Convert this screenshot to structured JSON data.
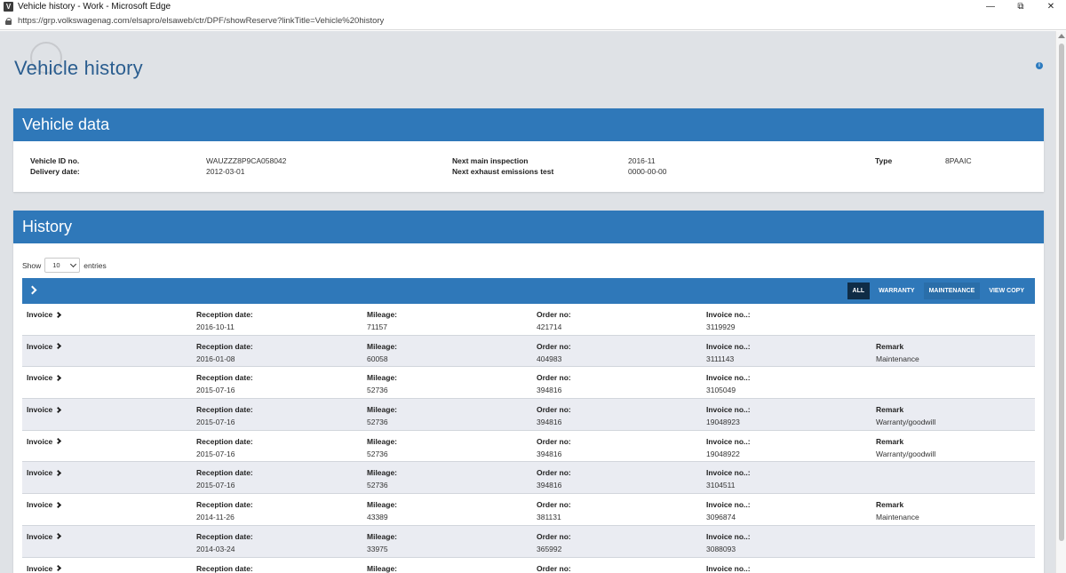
{
  "window": {
    "app_icon": "V",
    "title": "Vehicle history - Work - Microsoft Edge",
    "url": "https://grp.volkswagenag.com/elsapro/elsaweb/ctr/DPF/showReserve?linkTitle=Vehicle%20history"
  },
  "page": {
    "title": "Vehicle history",
    "info_icon": "i"
  },
  "vehicle_data": {
    "header": "Vehicle data",
    "vehicle_id_label": "Vehicle ID no.",
    "vehicle_id": "WAUZZZ8P9CA058042",
    "delivery_date_label": "Delivery date:",
    "delivery_date": "2012-03-01",
    "next_inspection_label": "Next main inspection",
    "next_inspection": "2016-11",
    "next_emissions_label": "Next exhaust emissions test",
    "next_emissions": "0000-00-00",
    "type_label": "Type",
    "type": "8PAAIC"
  },
  "history": {
    "header": "History",
    "show_label": "Show",
    "entries_value": "10",
    "entries_label": "entries",
    "filters": [
      "ALL",
      "WARRANTY",
      "MAINTENANCE",
      "VIEW COPY"
    ],
    "active_filter": "ALL",
    "labels": {
      "invoice": "Invoice",
      "reception_date": "Reception date:",
      "mileage": "Mileage:",
      "order_no": "Order no:",
      "invoice_no": "Invoice no..:",
      "remark": "Remark"
    },
    "rows": [
      {
        "reception_date": "2016-10-11",
        "mileage": "71157",
        "order_no": "421714",
        "invoice_no": "3119929",
        "remark": ""
      },
      {
        "reception_date": "2016-01-08",
        "mileage": "60058",
        "order_no": "404983",
        "invoice_no": "3111143",
        "remark": "Maintenance"
      },
      {
        "reception_date": "2015-07-16",
        "mileage": "52736",
        "order_no": "394816",
        "invoice_no": "3105049",
        "remark": ""
      },
      {
        "reception_date": "2015-07-16",
        "mileage": "52736",
        "order_no": "394816",
        "invoice_no": "19048923",
        "remark": "Warranty/goodwill"
      },
      {
        "reception_date": "2015-07-16",
        "mileage": "52736",
        "order_no": "394816",
        "invoice_no": "19048922",
        "remark": "Warranty/goodwill"
      },
      {
        "reception_date": "2015-07-16",
        "mileage": "52736",
        "order_no": "394816",
        "invoice_no": "3104511",
        "remark": ""
      },
      {
        "reception_date": "2014-11-26",
        "mileage": "43389",
        "order_no": "381131",
        "invoice_no": "3096874",
        "remark": "Maintenance"
      },
      {
        "reception_date": "2014-03-24",
        "mileage": "33975",
        "order_no": "365992",
        "invoice_no": "3088093",
        "remark": ""
      },
      {
        "reception_date": "",
        "mileage": "",
        "order_no": "",
        "invoice_no": "",
        "remark": ""
      }
    ]
  }
}
